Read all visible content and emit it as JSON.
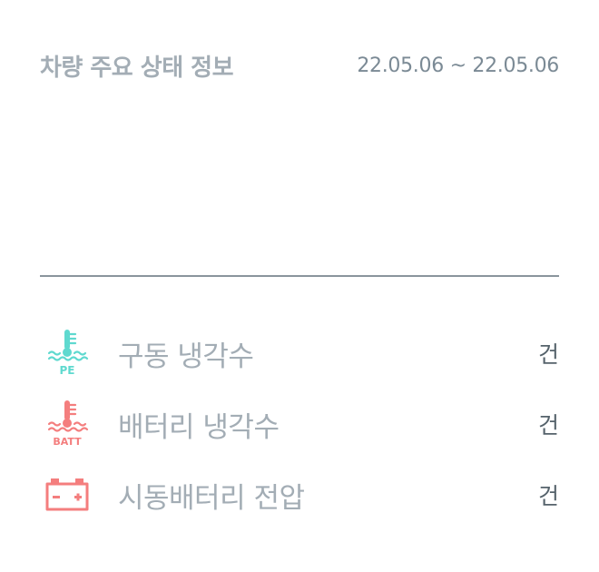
{
  "header": {
    "title": "차량 주요 상태 정보",
    "date_range": "22.05.06 ~ 22.05.06"
  },
  "rows": [
    {
      "label": "구동 냉각수",
      "icon": "pe-coolant-temp-icon",
      "icon_text": "PE",
      "icon_color": "#5fd9cf",
      "count": "",
      "unit": "건"
    },
    {
      "label": "배터리 냉각수",
      "icon": "battery-coolant-temp-icon",
      "icon_text": "BATT",
      "icon_color": "#f47e7e",
      "count": "",
      "unit": "건"
    },
    {
      "label": "시동배터리 전압",
      "icon": "starter-battery-icon",
      "icon_color": "#f47e7e",
      "count": "",
      "unit": "건"
    }
  ]
}
